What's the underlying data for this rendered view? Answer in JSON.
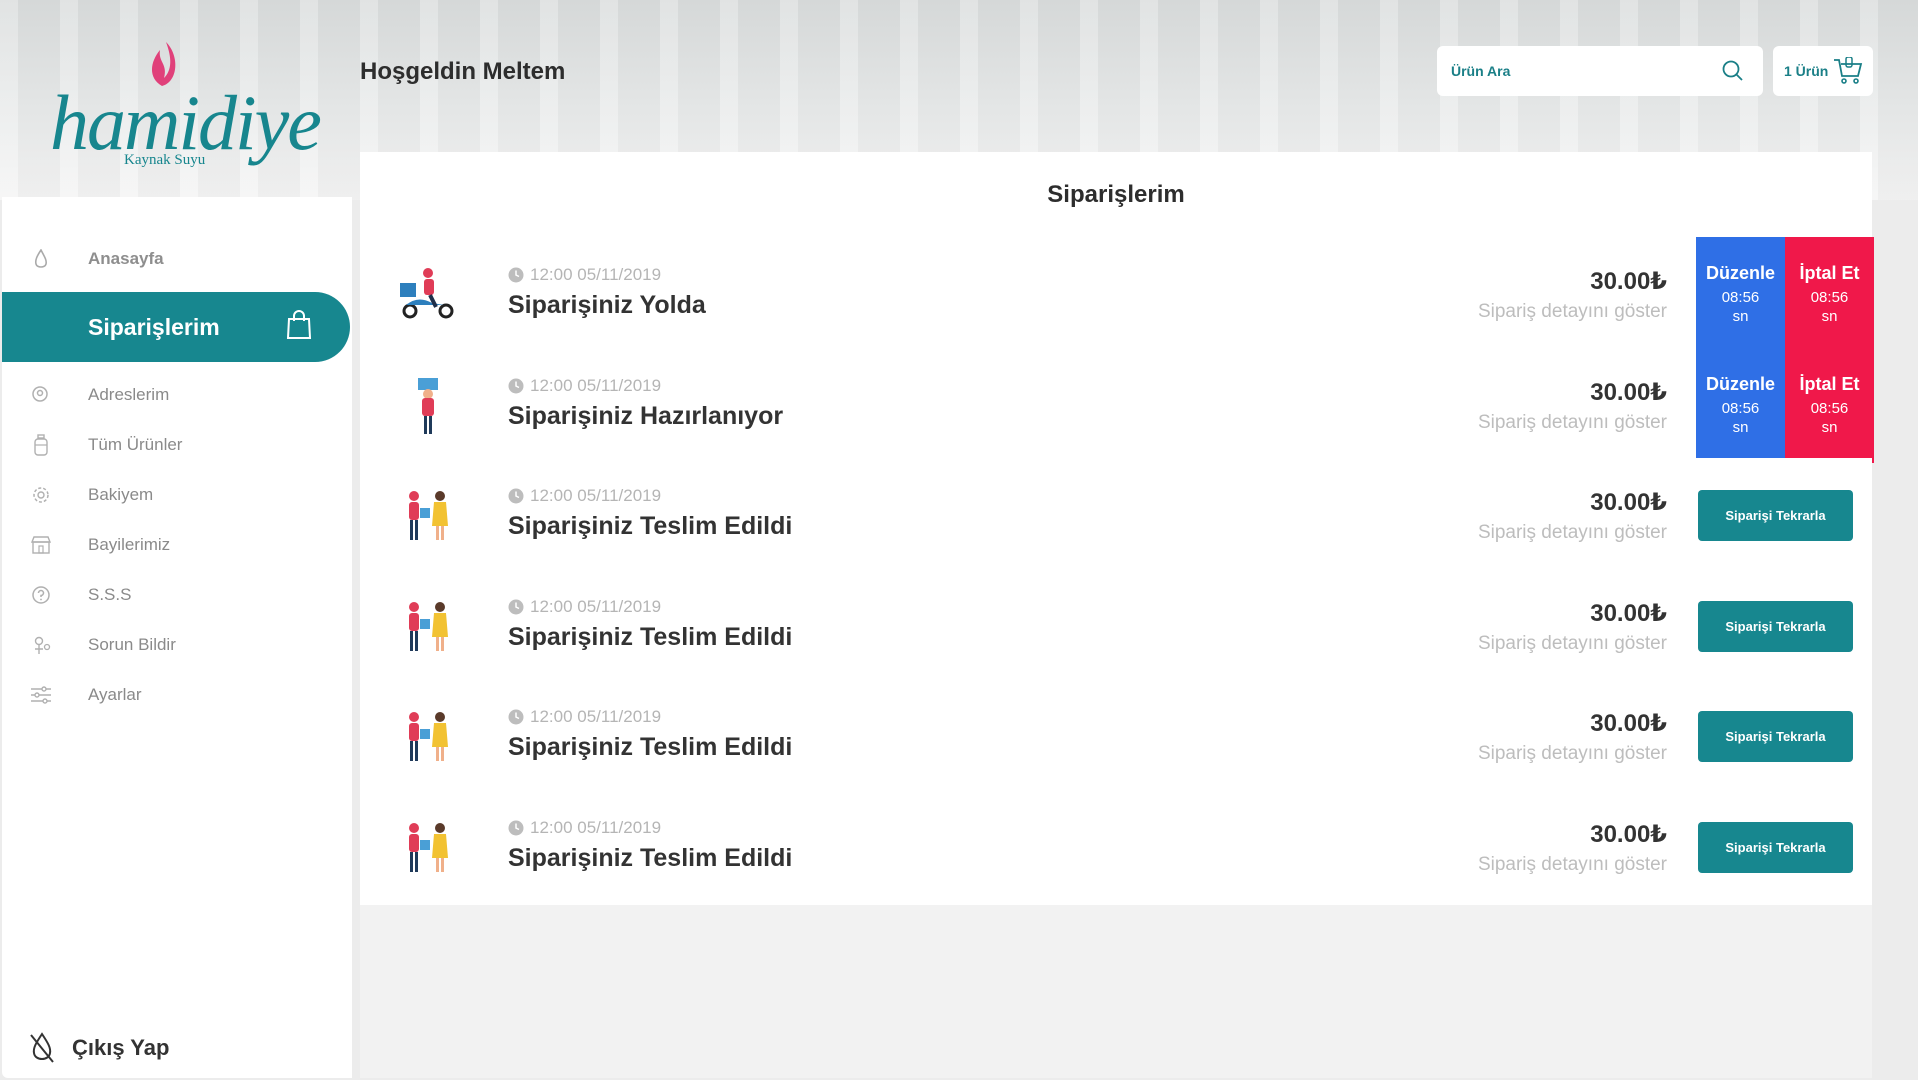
{
  "brand": {
    "name": "hamidiye",
    "tagline": "Kaynak Suyu",
    "color": "#17868e",
    "flame_color": "#e0407a"
  },
  "header": {
    "welcome": "Hoşgeldin Meltem",
    "search_placeholder": "Ürün Ara",
    "cart_label": "1 Ürün"
  },
  "sidebar": {
    "items": [
      {
        "label": "Anasayfa",
        "icon": "drop-icon"
      },
      {
        "label": "Siparişlerim",
        "icon": "shopping-bag-icon",
        "active": true
      },
      {
        "label": "Adreslerim",
        "icon": "location-icon"
      },
      {
        "label": "Tüm Ürünler",
        "icon": "bottle-icon"
      },
      {
        "label": "Bakiyem",
        "icon": "wallet-icon"
      },
      {
        "label": "Bayilerimiz",
        "icon": "store-icon"
      },
      {
        "label": "S.S.S",
        "icon": "question-icon"
      },
      {
        "label": "Sorun Bildir",
        "icon": "report-icon"
      },
      {
        "label": "Ayarlar",
        "icon": "settings-sliders-icon"
      }
    ],
    "logout": "Çıkış Yap"
  },
  "main": {
    "title": "Siparişlerim",
    "orders": [
      {
        "time": "12:00 05/11/2019",
        "status": "Siparişiniz Yolda",
        "price": "30.00₺",
        "detail": "Sipariş detayını göster",
        "illustration": "delivery-scooter-icon",
        "actions": {
          "edit": "Düzenle",
          "cancel": "İptal Et",
          "timer": "08:56",
          "unit": "sn"
        }
      },
      {
        "time": "12:00 05/11/2019",
        "status": "Siparişiniz Hazırlanıyor",
        "price": "30.00₺",
        "detail": "Sipariş detayını göster",
        "illustration": "courier-carrying-icon",
        "actions": {
          "edit": "Düzenle",
          "cancel": "İptal Et",
          "timer": "08:56",
          "unit": "sn"
        }
      },
      {
        "time": "12:00 05/11/2019",
        "status": "Siparişiniz Teslim Edildi",
        "price": "30.00₺",
        "detail": "Sipariş detayını göster",
        "illustration": "handover-icon",
        "repeat": "Siparişi Tekrarla"
      },
      {
        "time": "12:00 05/11/2019",
        "status": "Siparişiniz Teslim Edildi",
        "price": "30.00₺",
        "detail": "Sipariş detayını göster",
        "illustration": "handover-icon",
        "repeat": "Siparişi Tekrarla"
      },
      {
        "time": "12:00 05/11/2019",
        "status": "Siparişiniz Teslim Edildi",
        "price": "30.00₺",
        "detail": "Sipariş detayını göster",
        "illustration": "handover-icon",
        "repeat": "Siparişi Tekrarla"
      },
      {
        "time": "12:00 05/11/2019",
        "status": "Siparişiniz Teslim Edildi",
        "price": "30.00₺",
        "detail": "Sipariş detayını göster",
        "illustration": "handover-icon",
        "repeat": "Siparişi Tekrarla"
      }
    ]
  },
  "colors": {
    "accent": "#17878f",
    "edit": "#2f6fe6",
    "cancel": "#f0184a"
  }
}
